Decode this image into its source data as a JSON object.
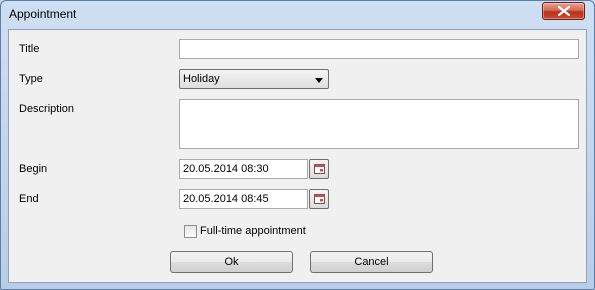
{
  "window": {
    "title": "Appointment",
    "close_icon": "close-icon"
  },
  "form": {
    "title_label": "Title",
    "title_value": "",
    "type_label": "Type",
    "type_value": "Holiday",
    "description_label": "Description",
    "description_value": "",
    "begin_label": "Begin",
    "begin_value": "20.05.2014 08:30",
    "end_label": "End",
    "end_value": "20.05.2014 08:45",
    "fulltime_label": "Full-time appointment",
    "fulltime_checked": false
  },
  "buttons": {
    "ok_label": "Ok",
    "cancel_label": "Cancel"
  },
  "colors": {
    "frame": "#b9cde6",
    "client_bg": "#f0f0f0",
    "close_button": "#c94a31"
  }
}
